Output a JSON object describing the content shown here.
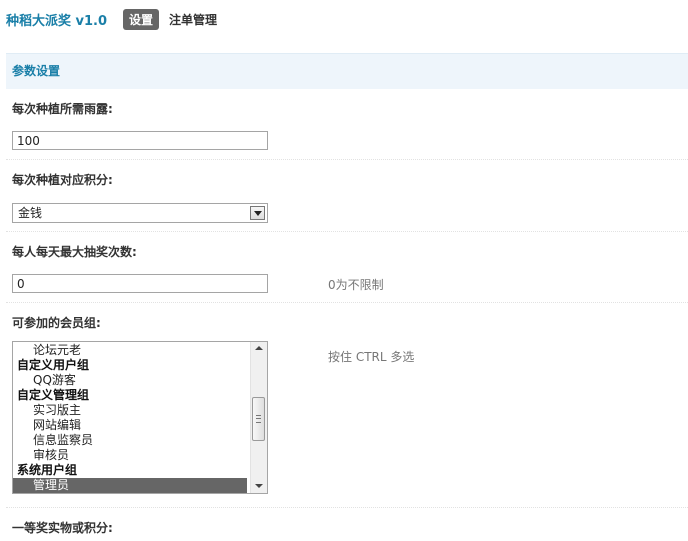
{
  "header": {
    "app_title": "种稻大派奖 v1.0",
    "tabs": [
      {
        "label": "设置",
        "active": true
      },
      {
        "label": "注单管理",
        "active": false
      }
    ]
  },
  "section": {
    "title": "参数设置"
  },
  "fields": {
    "rain_cost": {
      "label": "每次种植所需雨露:",
      "value": "100"
    },
    "credit_type": {
      "label": "每次种植对应积分:",
      "selected": "金钱"
    },
    "max_draws": {
      "label": "每人每天最大抽奖次数:",
      "value": "0",
      "hint": "0为不限制"
    },
    "member_groups": {
      "label": "可参加的会员组:",
      "hint": "按住 CTRL 多选",
      "options": [
        {
          "text": "论坛元老",
          "type": "item",
          "selected": false
        },
        {
          "text": "自定义用户组",
          "type": "group",
          "selected": false
        },
        {
          "text": "QQ游客",
          "type": "item",
          "selected": false
        },
        {
          "text": "自定义管理组",
          "type": "group",
          "selected": false
        },
        {
          "text": "实习版主",
          "type": "item",
          "selected": false
        },
        {
          "text": "网站编辑",
          "type": "item",
          "selected": false
        },
        {
          "text": "信息监察员",
          "type": "item",
          "selected": false
        },
        {
          "text": "审核员",
          "type": "item",
          "selected": false
        },
        {
          "text": "系统用户组",
          "type": "group",
          "selected": false
        },
        {
          "text": "管理员",
          "type": "item",
          "selected": true
        }
      ]
    },
    "first_prize": {
      "label": "一等奖实物或积分:"
    }
  },
  "colors": {
    "accent": "#1a7fa8",
    "section_bg": "#eef5fb",
    "selected_bg": "#666666"
  }
}
